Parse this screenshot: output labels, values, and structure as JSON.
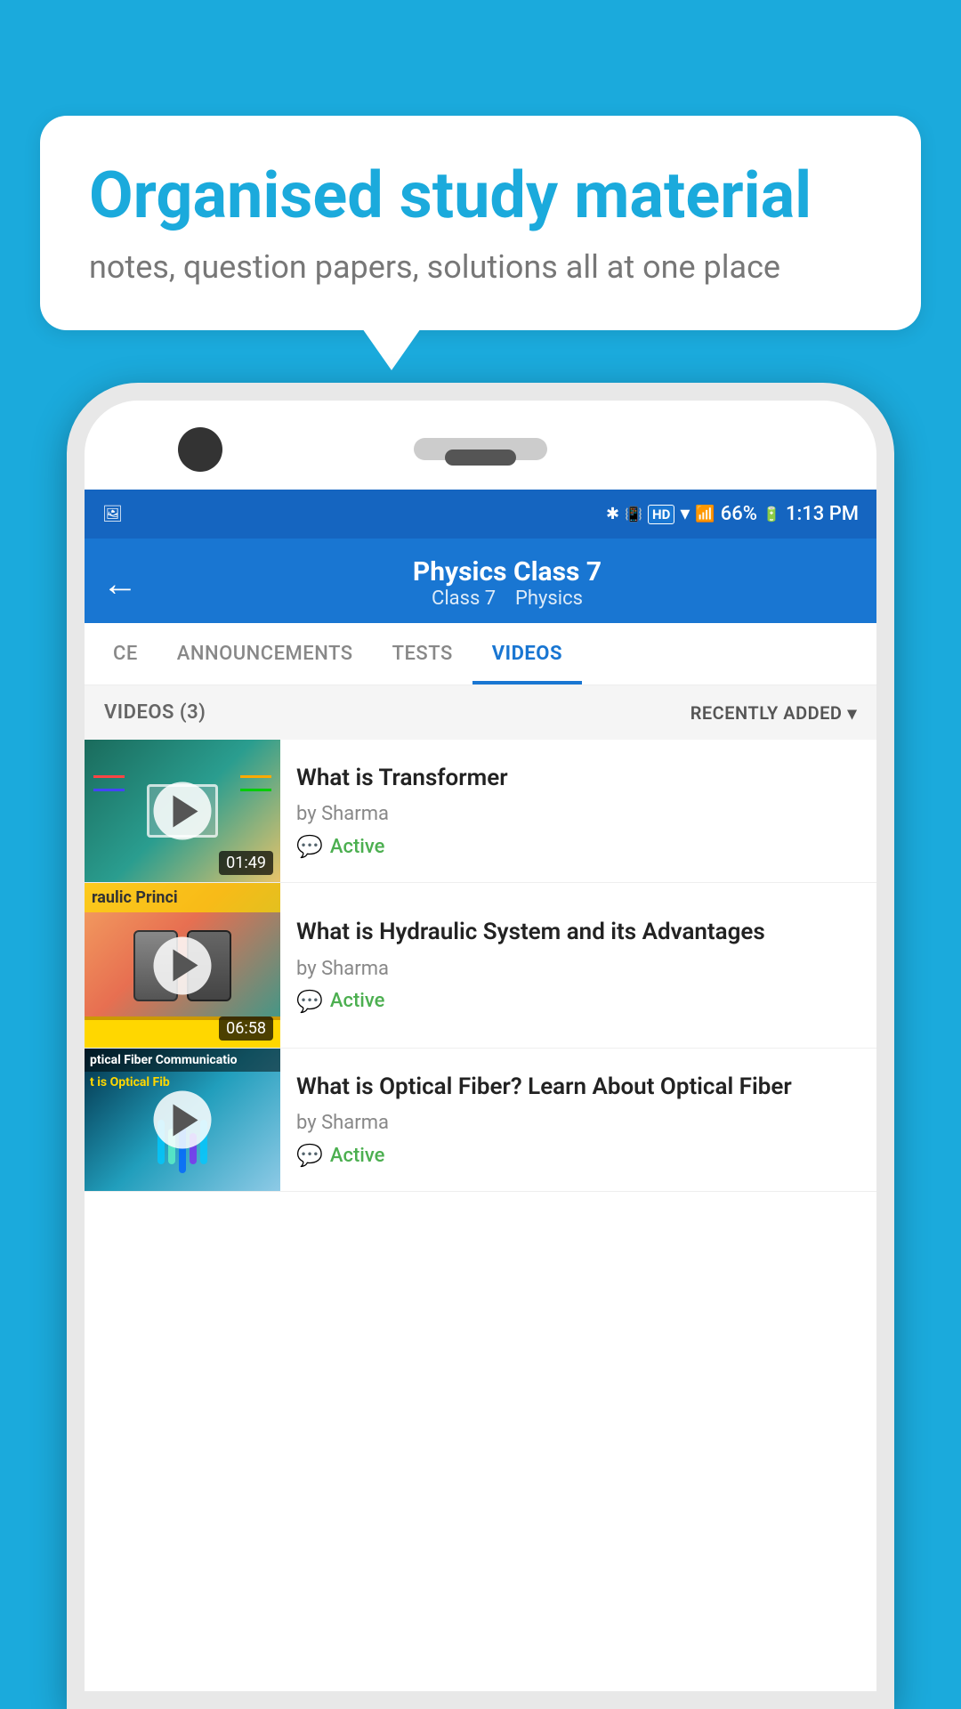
{
  "background_color": "#1BAADC",
  "speech_bubble": {
    "title": "Organised study material",
    "subtitle": "notes, question papers, solutions all at one place"
  },
  "phone": {
    "status_bar": {
      "battery": "66%",
      "time": "1:13 PM",
      "signal_icons": "🔵📶"
    },
    "header": {
      "title": "Physics Class 7",
      "subtitle_part1": "Class 7",
      "subtitle_separator": "  ",
      "subtitle_part2": "Physics",
      "back_label": "←"
    },
    "tabs": [
      {
        "id": "ce",
        "label": "CE",
        "active": false
      },
      {
        "id": "announcements",
        "label": "ANNOUNCEMENTS",
        "active": false
      },
      {
        "id": "tests",
        "label": "TESTS",
        "active": false
      },
      {
        "id": "videos",
        "label": "VIDEOS",
        "active": true
      }
    ],
    "list_header": {
      "count_label": "VIDEOS (3)",
      "sort_label": "RECENTLY ADDED",
      "sort_icon": "▾"
    },
    "videos": [
      {
        "id": "transformer",
        "title": "What is  Transformer",
        "author": "by Sharma",
        "status": "Active",
        "duration": "01:49",
        "thumbnail_type": "transformer"
      },
      {
        "id": "hydraulic",
        "title": "What is Hydraulic System and its Advantages",
        "author": "by Sharma",
        "status": "Active",
        "duration": "06:58",
        "thumbnail_type": "hydraulic",
        "thumbnail_text": "raulic Princi"
      },
      {
        "id": "optical",
        "title": "What is Optical Fiber? Learn About Optical Fiber",
        "author": "by Sharma",
        "status": "Active",
        "duration": "",
        "thumbnail_type": "optical",
        "thumbnail_text1": "ptical Fiber Communicatio",
        "thumbnail_text2": "t is Optical Fib"
      }
    ],
    "status_active_label": "Active",
    "chat_icon": "💬"
  }
}
